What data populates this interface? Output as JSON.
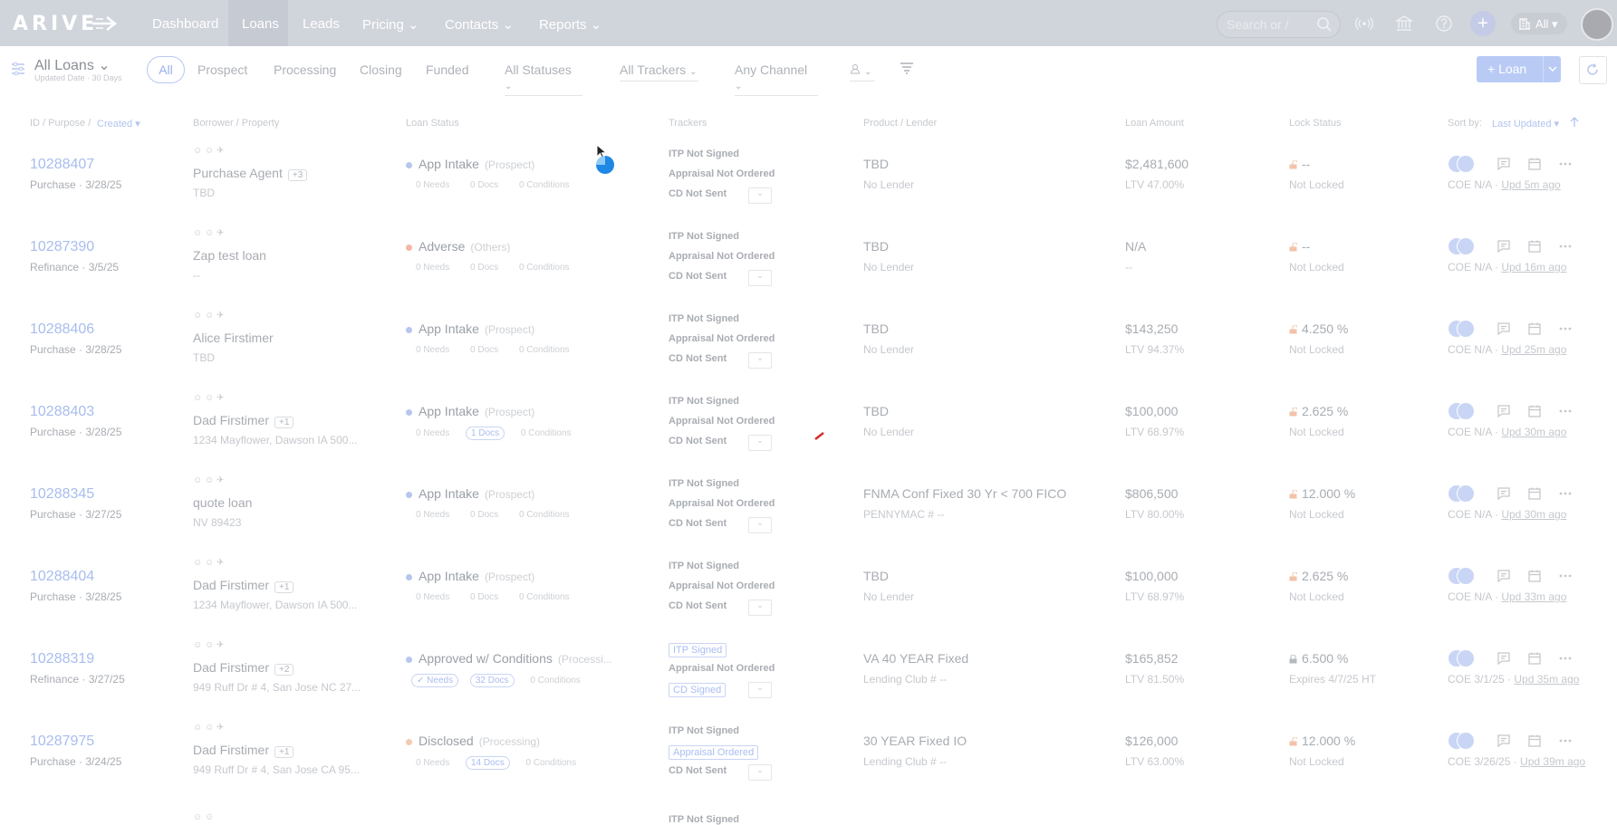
{
  "topnav": {
    "logo": "ARIVE",
    "items": [
      {
        "label": "Dashboard",
        "caret": false
      },
      {
        "label": "Loans",
        "caret": false
      },
      {
        "label": "Leads",
        "caret": false
      },
      {
        "label": "Pricing",
        "caret": true
      },
      {
        "label": "Contacts",
        "caret": true
      },
      {
        "label": "Reports",
        "caret": true
      }
    ],
    "search_placeholder": "Search or /",
    "all_label": "All ▾"
  },
  "subbar": {
    "view_title": "All Loans",
    "view_subtitle": "Updated Date · 30 Days",
    "tabs": [
      "All",
      "Prospect",
      "Processing",
      "Closing",
      "Funded"
    ],
    "dropdowns": [
      "All Statuses",
      "All Trackers",
      "Any Channel"
    ],
    "new_loan_label": "+ Loan"
  },
  "columns": {
    "id_purpose": "ID / Purpose /",
    "created": "Created ▾",
    "borrower": "Borrower / Property",
    "loan_status": "Loan Status",
    "trackers": "Trackers",
    "product": "Product / Lender",
    "amount": "Loan Amount",
    "lock": "Lock Status",
    "sort_by": "Sort by:",
    "sort_value": "Last Updated ▾"
  },
  "rows": [
    {
      "id": "10288407",
      "purpose": "Purchase · 3/28/25",
      "borrower": "Purchase Agent",
      "plus": "+3",
      "property": "TBD",
      "status": "App Intake",
      "status_sub": "(Prospect)",
      "dot": "#b6c6ef",
      "needs": "0 Needs",
      "docs": "0 Docs",
      "conds": "0 Conditions",
      "docs_hl": false,
      "needs_ok": false,
      "itp": "ITP Not Signed",
      "appraisal": "Appraisal Not Ordered",
      "cd": "CD Not Sent",
      "itp_box": false,
      "app_box": false,
      "cd_box": false,
      "product": "TBD",
      "lender": "No Lender",
      "amount": "$2,481,600",
      "ltv": "LTV 47.00%",
      "lock": "--",
      "lockst": "Not Locked",
      "coe": "COE N/A · ",
      "upd": "Upd 5m ago"
    },
    {
      "id": "10287390",
      "purpose": "Refinance · 3/5/25",
      "borrower": "Zap test loan",
      "plus": "",
      "property": "--",
      "status": "Adverse",
      "status_sub": "(Others)",
      "dot": "#f2b7a6",
      "needs": "0 Needs",
      "docs": "0 Docs",
      "conds": "0 Conditions",
      "docs_hl": false,
      "needs_ok": false,
      "itp": "ITP Not Signed",
      "appraisal": "Appraisal Not Ordered",
      "cd": "CD Not Sent",
      "itp_box": false,
      "app_box": false,
      "cd_box": false,
      "product": "TBD",
      "lender": "No Lender",
      "amount": "N/A",
      "ltv": "--",
      "lock": "--",
      "lockst": "Not Locked",
      "coe": "COE N/A · ",
      "upd": "Upd 16m ago"
    },
    {
      "id": "10288406",
      "purpose": "Purchase · 3/28/25",
      "borrower": "Alice Firstimer",
      "plus": "",
      "property": "TBD",
      "status": "App Intake",
      "status_sub": "(Prospect)",
      "dot": "#b6c6ef",
      "needs": "0 Needs",
      "docs": "0 Docs",
      "conds": "0 Conditions",
      "docs_hl": false,
      "needs_ok": false,
      "itp": "ITP Not Signed",
      "appraisal": "Appraisal Not Ordered",
      "cd": "CD Not Sent",
      "itp_box": false,
      "app_box": false,
      "cd_box": false,
      "product": "TBD",
      "lender": "No Lender",
      "amount": "$143,250",
      "ltv": "LTV 94.37%",
      "lock": "4.250 %",
      "lockst": "Not Locked",
      "coe": "COE N/A · ",
      "upd": "Upd 25m ago"
    },
    {
      "id": "10288403",
      "purpose": "Purchase · 3/28/25",
      "borrower": "Dad Firstimer",
      "plus": "+1",
      "property": "1234 Mayflower, Dawson IA 500...",
      "status": "App Intake",
      "status_sub": "(Prospect)",
      "dot": "#b6c6ef",
      "needs": "0 Needs",
      "docs": "1 Docs",
      "conds": "0 Conditions",
      "docs_hl": true,
      "needs_ok": false,
      "itp": "ITP Not Signed",
      "appraisal": "Appraisal Not Ordered",
      "cd": "CD Not Sent",
      "itp_box": false,
      "app_box": false,
      "cd_box": false,
      "product": "TBD",
      "lender": "No Lender",
      "amount": "$100,000",
      "ltv": "LTV 68.97%",
      "lock": "2.625 %",
      "lockst": "Not Locked",
      "coe": "COE N/A · ",
      "upd": "Upd 30m ago"
    },
    {
      "id": "10288345",
      "purpose": "Purchase · 3/27/25",
      "borrower": "quote loan",
      "plus": "",
      "property": "NV 89423",
      "status": "App Intake",
      "status_sub": "(Prospect)",
      "dot": "#b6c6ef",
      "needs": "0 Needs",
      "docs": "0 Docs",
      "conds": "0 Conditions",
      "docs_hl": false,
      "needs_ok": false,
      "itp": "ITP Not Signed",
      "appraisal": "Appraisal Not Ordered",
      "cd": "CD Not Sent",
      "itp_box": false,
      "app_box": false,
      "cd_box": false,
      "product": "FNMA Conf Fixed 30 Yr < 700 FICO",
      "lender": "PENNYMAC # --",
      "amount": "$806,500",
      "ltv": "LTV 80.00%",
      "lock": "12.000 %",
      "lockst": "Not Locked",
      "coe": "COE N/A · ",
      "upd": "Upd 30m ago"
    },
    {
      "id": "10288404",
      "purpose": "Purchase · 3/28/25",
      "borrower": "Dad Firstimer",
      "plus": "+1",
      "property": "1234 Mayflower, Dawson IA 500...",
      "status": "App Intake",
      "status_sub": "(Prospect)",
      "dot": "#b6c6ef",
      "needs": "0 Needs",
      "docs": "0 Docs",
      "conds": "0 Conditions",
      "docs_hl": false,
      "needs_ok": false,
      "itp": "ITP Not Signed",
      "appraisal": "Appraisal Not Ordered",
      "cd": "CD Not Sent",
      "itp_box": false,
      "app_box": false,
      "cd_box": false,
      "product": "TBD",
      "lender": "No Lender",
      "amount": "$100,000",
      "ltv": "LTV 68.97%",
      "lock": "2.625 %",
      "lockst": "Not Locked",
      "coe": "COE N/A · ",
      "upd": "Upd 33m ago"
    },
    {
      "id": "10288319",
      "purpose": "Refinance · 3/27/25",
      "borrower": "Dad Firstimer",
      "plus": "+2",
      "property": "949 Ruff Dr # 4, San Jose NC 27...",
      "status": "Approved w/ Conditions",
      "status_sub": "(Processi...",
      "dot": "#b6c6ef",
      "needs": "✓ Needs",
      "docs": "32 Docs",
      "conds": "0 Conditions",
      "docs_hl": true,
      "needs_ok": true,
      "itp": "ITP Signed",
      "appraisal": "Appraisal Not Ordered",
      "cd": "CD Signed",
      "itp_box": true,
      "app_box": false,
      "cd_box": true,
      "product": "VA 40 YEAR Fixed",
      "lender": "Lending Club # --",
      "amount": "$165,852",
      "ltv": "LTV 81.50%",
      "lock": "6.500 %",
      "lockst": "Expires 4/7/25 HT",
      "coe": "COE 3/1/25 · ",
      "upd": "Upd 35m ago"
    },
    {
      "id": "10287975",
      "purpose": "Purchase · 3/24/25",
      "borrower": "Dad Firstimer",
      "plus": "+1",
      "property": "949 Ruff Dr # 4, San Jose CA 95...",
      "status": "Disclosed",
      "status_sub": "(Processing)",
      "dot": "#f2cbb0",
      "needs": "0 Needs",
      "docs": "14 Docs",
      "conds": "0 Conditions",
      "docs_hl": true,
      "needs_ok": false,
      "itp": "ITP Not Signed",
      "appraisal": "Appraisal Ordered",
      "cd": "CD Not Sent",
      "itp_box": false,
      "app_box": true,
      "cd_box": false,
      "product": "30 YEAR Fixed IO",
      "lender": "Lending Club # --",
      "amount": "$126,000",
      "ltv": "LTV 63.00%",
      "lock": "12.000 %",
      "lockst": "Not Locked",
      "coe": "COE 3/26/25 · ",
      "upd": "Upd 39m ago"
    }
  ],
  "partial_row": {
    "itp": "ITP Not Signed"
  }
}
